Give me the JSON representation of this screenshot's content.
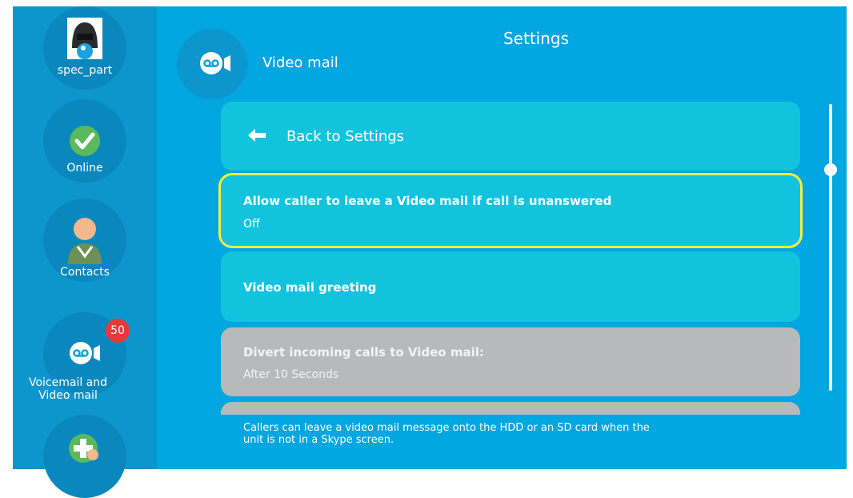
{
  "header": {
    "title": "Settings",
    "subtitle": "Video mail"
  },
  "sidebar": {
    "items": [
      {
        "label": "spec_part",
        "icon": "avatar-icon"
      },
      {
        "label": "Online",
        "icon": "online-check-icon"
      },
      {
        "label": "Contacts",
        "icon": "contacts-icon"
      },
      {
        "label": "Voicemail and Video mail",
        "icon": "voicemail-icon",
        "badge": "50"
      },
      {
        "label": "Add contact",
        "icon": "add-contact-icon"
      }
    ]
  },
  "menu": {
    "back": {
      "label": "Back to Settings",
      "icon": "back-arrow-icon"
    },
    "items": [
      {
        "title": "Allow caller to leave a Video mail if call is unanswered",
        "value": "Off",
        "selected": true
      },
      {
        "title": "Video mail greeting",
        "value": ""
      },
      {
        "title": "Divert incoming calls to Video mail:",
        "value": "After 10 Seconds",
        "disabled": true
      }
    ]
  },
  "footer": {
    "help": "Callers can leave a video mail message onto the HDD or an SD card when the unit is not in a Skype screen."
  },
  "scroll": {
    "position": 0.23
  },
  "colors": {
    "background": "#02a6e0",
    "sidebar": "#0c96cd",
    "card": "#12c3de",
    "card_disabled": "#b8b9ba",
    "selection": "#f3ee3f",
    "badge": "#e63a3a"
  }
}
